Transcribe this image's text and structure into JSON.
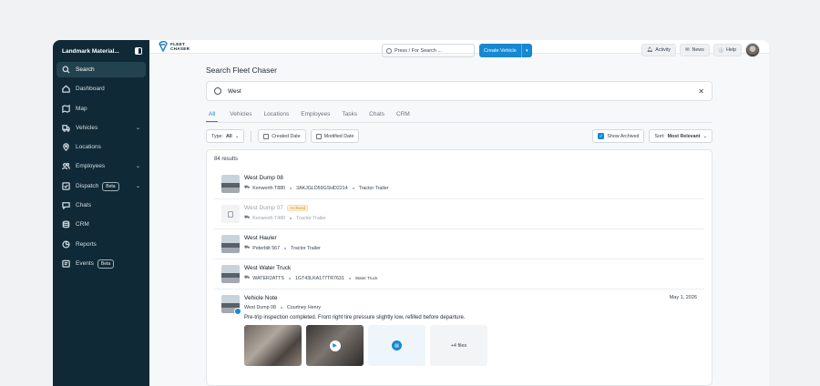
{
  "sidebar": {
    "org_name": "Landmark Material...",
    "items": [
      {
        "label": "Search",
        "icon": "search-icon"
      },
      {
        "label": "Dashboard",
        "icon": "home-icon"
      },
      {
        "label": "Map",
        "icon": "map-icon"
      },
      {
        "label": "Vehicles",
        "icon": "truck-icon"
      },
      {
        "label": "Locations",
        "icon": "location-pin-icon"
      },
      {
        "label": "Employees",
        "icon": "users-icon"
      },
      {
        "label": "Dispatch",
        "icon": "dispatch-icon",
        "badge": "Beta"
      },
      {
        "label": "Chats",
        "icon": "chat-icon"
      },
      {
        "label": "CRM",
        "icon": "database-icon"
      },
      {
        "label": "Reports",
        "icon": "pie-chart-icon"
      },
      {
        "label": "Events",
        "icon": "events-icon",
        "badge": "Beta"
      }
    ]
  },
  "topbar": {
    "logo_line1": "FLEET",
    "logo_line2": "CHASER",
    "search_placeholder": "Press / For Search ...",
    "create_label": "Create Vehicle",
    "activity": "Activity",
    "news": "News",
    "help": "Help"
  },
  "page": {
    "title": "Search Fleet Chaser",
    "query": "West",
    "tabs": [
      "All",
      "Vehicles",
      "Locations",
      "Employees",
      "Tasks",
      "Chats",
      "CRM"
    ],
    "filters": {
      "type_label": "Type:",
      "type_value": "All",
      "created": "Created Date",
      "modified": "Modified Date",
      "show_archived": "Show Archived",
      "sort_label": "Sort:",
      "sort_value": "Most Relevant"
    },
    "result_count": "84 results",
    "results": [
      {
        "name": "West Dump 08",
        "model": "Kenworth T880",
        "vin": "3AKJGLD59GSHD2214",
        "type": "Tractor Trailer"
      },
      {
        "name": "West Dump 07",
        "badge": "Archived",
        "model": "Kenworth T480",
        "type": "Tractor Trailer"
      },
      {
        "name": "West Hauler",
        "model": "Peterbilt 567",
        "type": "Tractor Trailer"
      },
      {
        "name": "West Water Truck",
        "model": "WATER2ATTS",
        "vin": "1GT43LKA177TR7631",
        "type": "Water Truck"
      }
    ],
    "note": {
      "title": "Vehicle Note",
      "date": "May 1, 2026",
      "vehicle": "West Dump 08",
      "author": "Courtney Henry",
      "text": "Pre-trip inspection completed. Front right tire pressure slightly low, refilled before departure.",
      "more_files": "+4 files"
    }
  }
}
